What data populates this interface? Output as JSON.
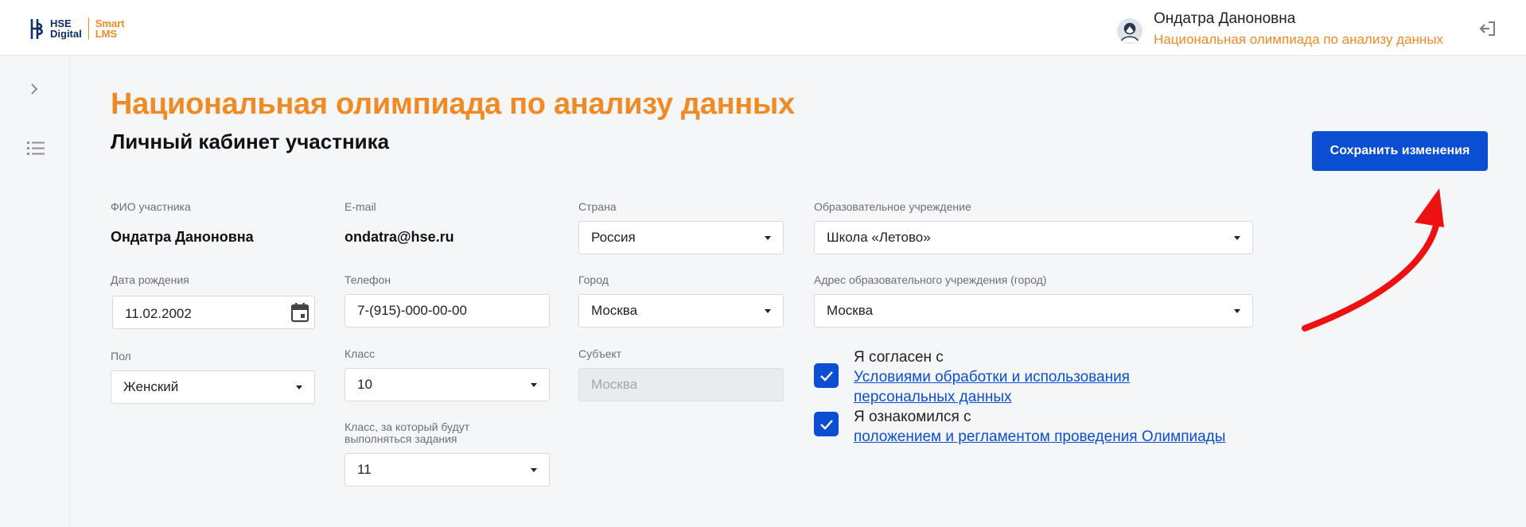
{
  "header": {
    "logo_line1": "HSE",
    "logo_line2": "Digital",
    "logo_lms1": "Smart",
    "logo_lms2": "LMS",
    "user_name": "Ондатра Даноновна",
    "user_course": "Национальная олимпиада по анализу данных"
  },
  "page": {
    "title": "Национальная олимпиада по анализу данных",
    "subtitle": "Личный кабинет участника",
    "save_label": "Сохранить изменения"
  },
  "form": {
    "fio_label": "ФИО участника",
    "fio_value": "Ондатра Даноновна",
    "birth_label": "Дата рождения",
    "birth_value": "11.02.2002",
    "gender_label": "Пол",
    "gender_value": "Женский",
    "email_label": "E-mail",
    "email_value": "ondatra@hse.ru",
    "phone_label": "Телефон",
    "phone_value": "7-(915)-000-00-00",
    "class_label": "Класс",
    "class_value": "10",
    "task_class_label_1": "Класс, за который будут",
    "task_class_label_2": "выполняться задания",
    "task_class_value": "11",
    "country_label": "Страна",
    "country_value": "Россия",
    "city_label": "Город",
    "city_value": "Москва",
    "subject_label": "Субъект",
    "subject_value": "Москва",
    "school_label": "Образовательное учреждение",
    "school_value": "Школа «Летово»",
    "school_addr_label": "Адрес образовательного учреждения (город)",
    "school_addr_value": "Москва"
  },
  "consent": {
    "c1_text": "Я согласен с",
    "c1_link_1": "Условиями обработки и использования",
    "c1_link_2": "персональных данных",
    "c2_text": "Я ознакомился с",
    "c2_link": "положением и регламентом проведения Олимпиады"
  },
  "colors": {
    "accent": "#f08a24",
    "primary": "#0a4fd1",
    "annotation_arrow": "#ee1111"
  }
}
